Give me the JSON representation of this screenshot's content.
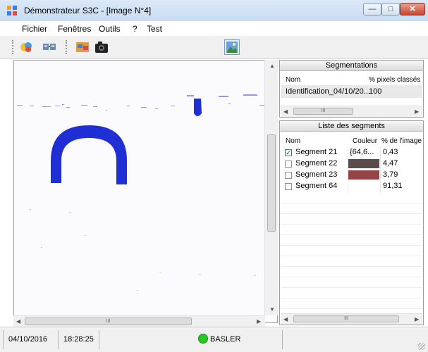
{
  "window": {
    "title": "Démonstrateur S3C - [Image N°4]"
  },
  "menu": {
    "items": [
      "Fichier",
      "Fenêtres",
      "Outils",
      "?",
      "Test"
    ]
  },
  "segmentations": {
    "title": "Segmentations",
    "columns": [
      "Nom",
      "% pixels classés"
    ],
    "rows": [
      {
        "nom": "Identification_04/10/20...",
        "pct": "100"
      }
    ]
  },
  "segments": {
    "title": "Liste des segments",
    "columns": [
      "Nom",
      "Couleur",
      "% de l'image"
    ],
    "rows": [
      {
        "nom": "Segment 21",
        "checked": true,
        "couleur_text": "{64,6...",
        "color": "",
        "pct": "0,43"
      },
      {
        "nom": "Segment 22",
        "checked": false,
        "couleur_text": "",
        "color": "#5b4c4c",
        "pct": "4,47"
      },
      {
        "nom": "Segment 23",
        "checked": false,
        "couleur_text": "",
        "color": "#944444",
        "pct": "3,79"
      },
      {
        "nom": "Segment 64",
        "checked": false,
        "couleur_text": "",
        "color": "",
        "pct": "91,31"
      }
    ]
  },
  "scroll_ellipsis": "III",
  "status": {
    "date": "04/10/2016",
    "time": "18:28:25",
    "camera": "BASLER",
    "camera_color": "#22cc22"
  },
  "colors": {
    "segment_blue": "#1f2fd4"
  },
  "icons": [
    "app-icon",
    "open-color-icon",
    "camera-connect-icon",
    "folder-images-icon",
    "camera-icon",
    "image-landscape-icon"
  ]
}
